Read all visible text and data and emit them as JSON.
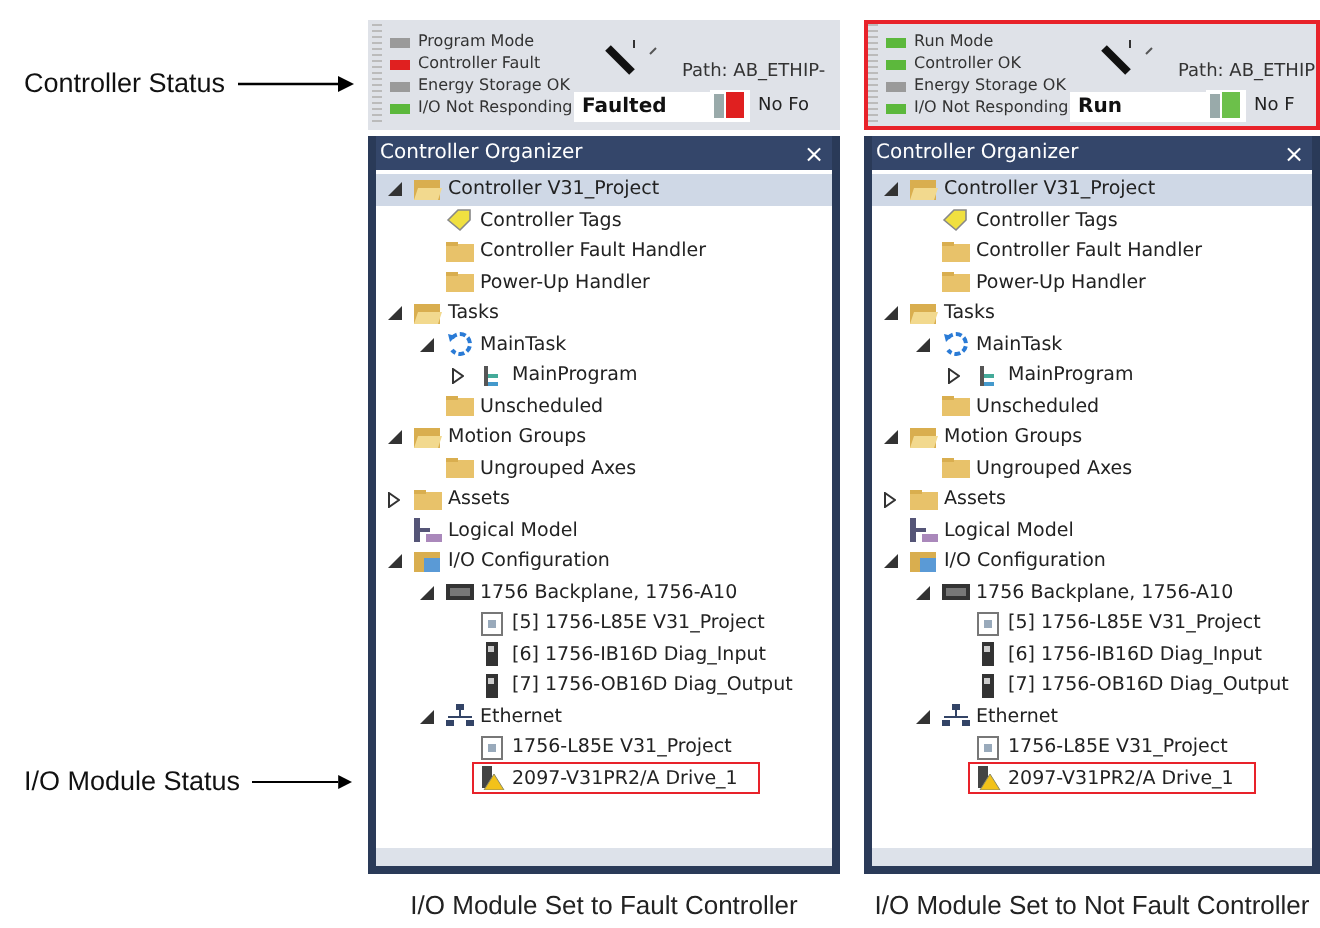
{
  "callouts": [
    {
      "label": "Controller Status"
    },
    {
      "label": "I/O Module Status"
    }
  ],
  "panels": [
    {
      "status": {
        "highlighted": false,
        "indicators": [
          {
            "label": "Program Mode",
            "color": "#9a9a9a"
          },
          {
            "label": "Controller Fault",
            "color": "#e02020"
          },
          {
            "label": "Energy Storage OK",
            "color": "#9a9a9a"
          },
          {
            "label": "I/O Not Responding",
            "color": "#5cb83c"
          }
        ],
        "path": "Path: AB_ETHIP-",
        "mode": "Faulted",
        "faulted": true,
        "extra": "No Fo"
      },
      "organizer": {
        "title": "Controller Organizer",
        "close": "×",
        "tree": [
          {
            "label": "Controller V31_Project",
            "kind": "folder-open",
            "expanded": true,
            "selected": true,
            "boxed": false,
            "children": [
              {
                "label": "Controller Tags",
                "kind": "tag",
                "selected": false,
                "boxed": false
              },
              {
                "label": "Controller Fault Handler",
                "kind": "folder",
                "selected": false,
                "boxed": false
              },
              {
                "label": "Power-Up Handler",
                "kind": "folder",
                "selected": false,
                "boxed": false
              }
            ]
          },
          {
            "label": "Tasks",
            "kind": "folder-open",
            "expanded": true,
            "selected": false,
            "boxed": false,
            "children": [
              {
                "label": "MainTask",
                "kind": "task",
                "expanded": true,
                "selected": false,
                "boxed": false,
                "children": [
                  {
                    "label": "MainProgram",
                    "kind": "program",
                    "expanded": false,
                    "selected": false,
                    "boxed": false
                  }
                ]
              },
              {
                "label": "Unscheduled",
                "kind": "folder",
                "selected": false,
                "boxed": false
              }
            ]
          },
          {
            "label": "Motion Groups",
            "kind": "folder-open",
            "expanded": true,
            "selected": false,
            "boxed": false,
            "children": [
              {
                "label": "Ungrouped Axes",
                "kind": "folder",
                "selected": false,
                "boxed": false
              }
            ]
          },
          {
            "label": "Assets",
            "kind": "folder",
            "expanded": false,
            "selected": false,
            "boxed": false
          },
          {
            "label": "Logical Model",
            "kind": "logical",
            "selected": false,
            "boxed": false
          },
          {
            "label": "I/O Configuration",
            "kind": "io",
            "expanded": true,
            "selected": false,
            "boxed": false,
            "children": [
              {
                "label": "1756 Backplane, 1756-A10",
                "kind": "backplane",
                "expanded": true,
                "selected": false,
                "boxed": false,
                "children": [
                  {
                    "label": "[5] 1756-L85E V31_Project",
                    "kind": "controller",
                    "selected": false,
                    "boxed": false
                  },
                  {
                    "label": "[6] 1756-IB16D Diag_Input",
                    "kind": "module",
                    "selected": false,
                    "boxed": false
                  },
                  {
                    "label": "[7] 1756-OB16D Diag_Output",
                    "kind": "module",
                    "selected": false,
                    "boxed": false
                  }
                ]
              },
              {
                "label": "Ethernet",
                "kind": "network",
                "expanded": true,
                "selected": false,
                "boxed": false,
                "children": [
                  {
                    "label": "1756-L85E V31_Project",
                    "kind": "controller",
                    "selected": false,
                    "boxed": false
                  },
                  {
                    "label": "2097-V31PR2/A Drive_1",
                    "kind": "drive-warning",
                    "selected": false,
                    "boxed": true
                  }
                ]
              }
            ]
          }
        ]
      },
      "caption": "I/O Module Set to Fault Controller"
    },
    {
      "status": {
        "highlighted": true,
        "indicators": [
          {
            "label": "Run Mode",
            "color": "#5cb83c"
          },
          {
            "label": "Controller OK",
            "color": "#5cb83c"
          },
          {
            "label": "Energy Storage OK",
            "color": "#9a9a9a"
          },
          {
            "label": "I/O Not Responding",
            "color": "#5cb83c"
          }
        ],
        "path": "Path: AB_ETHIP",
        "mode": "Run",
        "faulted": false,
        "extra": "No F"
      },
      "organizer": {
        "title": "Controller Organizer",
        "close": "×",
        "tree": [
          {
            "label": "Controller V31_Project",
            "kind": "folder-open",
            "expanded": true,
            "selected": true,
            "boxed": false,
            "children": [
              {
                "label": "Controller Tags",
                "kind": "tag",
                "selected": false,
                "boxed": false
              },
              {
                "label": "Controller Fault Handler",
                "kind": "folder",
                "selected": false,
                "boxed": false
              },
              {
                "label": "Power-Up Handler",
                "kind": "folder",
                "selected": false,
                "boxed": false
              }
            ]
          },
          {
            "label": "Tasks",
            "kind": "folder-open",
            "expanded": true,
            "selected": false,
            "boxed": false,
            "children": [
              {
                "label": "MainTask",
                "kind": "task",
                "expanded": true,
                "selected": false,
                "boxed": false,
                "children": [
                  {
                    "label": "MainProgram",
                    "kind": "program",
                    "expanded": false,
                    "selected": false,
                    "boxed": false
                  }
                ]
              },
              {
                "label": "Unscheduled",
                "kind": "folder",
                "selected": false,
                "boxed": false
              }
            ]
          },
          {
            "label": "Motion Groups",
            "kind": "folder-open",
            "expanded": true,
            "selected": false,
            "boxed": false,
            "children": [
              {
                "label": "Ungrouped Axes",
                "kind": "folder",
                "selected": false,
                "boxed": false
              }
            ]
          },
          {
            "label": "Assets",
            "kind": "folder",
            "expanded": false,
            "selected": false,
            "boxed": false
          },
          {
            "label": "Logical Model",
            "kind": "logical",
            "selected": false,
            "boxed": false
          },
          {
            "label": "I/O Configuration",
            "kind": "io",
            "expanded": true,
            "selected": false,
            "boxed": false,
            "children": [
              {
                "label": "1756 Backplane, 1756-A10",
                "kind": "backplane",
                "expanded": true,
                "selected": false,
                "boxed": false,
                "children": [
                  {
                    "label": "[5] 1756-L85E V31_Project",
                    "kind": "controller",
                    "selected": false,
                    "boxed": false
                  },
                  {
                    "label": "[6] 1756-IB16D Diag_Input",
                    "kind": "module",
                    "selected": false,
                    "boxed": false
                  },
                  {
                    "label": "[7] 1756-OB16D Diag_Output",
                    "kind": "module",
                    "selected": false,
                    "boxed": false
                  }
                ]
              },
              {
                "label": "Ethernet",
                "kind": "network",
                "expanded": true,
                "selected": false,
                "boxed": false,
                "children": [
                  {
                    "label": "1756-L85E V31_Project",
                    "kind": "controller",
                    "selected": false,
                    "boxed": false
                  },
                  {
                    "label": "2097-V31PR2/A Drive_1",
                    "kind": "drive-warning",
                    "selected": false,
                    "boxed": true
                  }
                ]
              }
            ]
          }
        ]
      },
      "caption": "I/O Module Set to Not Fault Controller"
    }
  ]
}
